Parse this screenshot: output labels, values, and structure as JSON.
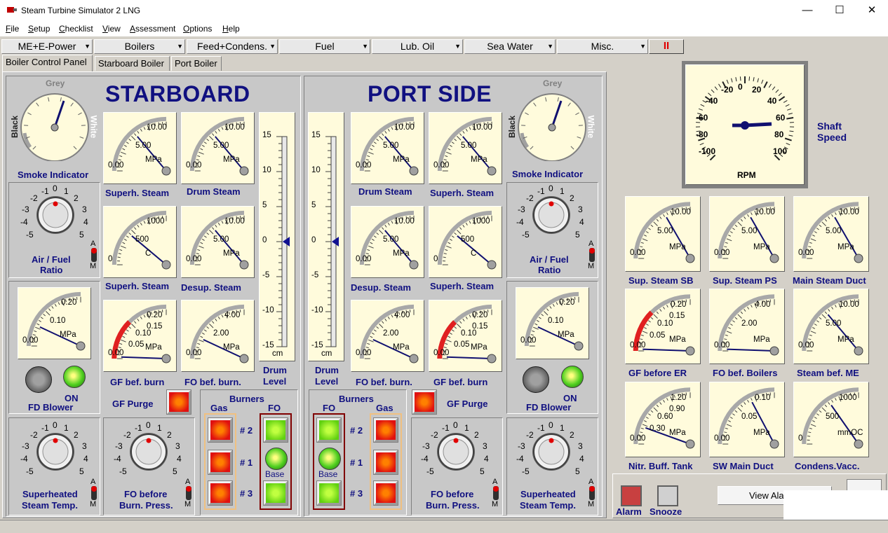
{
  "window": {
    "title": "Steam Turbine Simulator 2 LNG"
  },
  "menu": [
    "File",
    "Setup",
    "Checklist",
    "View",
    "Assessment",
    "Options",
    "Help"
  ],
  "systems": [
    "ME+E-Power",
    "Boilers",
    "Feed+Condens.",
    "Fuel",
    "Lub. Oil",
    "Sea Water",
    "Misc."
  ],
  "pause_label": "II",
  "tabs": [
    "Boiler Control Panel",
    "Starboard Boiler",
    "Port Boiler"
  ],
  "starboard": {
    "title": "STARBOARD",
    "smoke": {
      "label": "Smoke Indicator",
      "top": "Grey",
      "left": "Black",
      "right": "White"
    },
    "air_fuel": {
      "label1": "Air / Fuel",
      "label2": "Ratio"
    },
    "fd_blower": {
      "label": "FD Blower",
      "state": "ON"
    },
    "sh_temp": {
      "label1": "Superheated",
      "label2": "Steam Temp."
    },
    "fo_press": {
      "label1": "FO before",
      "label2": "Burn. Press."
    },
    "gf_purge": "GF Purge",
    "burners": {
      "title": "Burners",
      "gas": "Gas",
      "fo": "FO",
      "n2": "# 2",
      "n1": "# 1",
      "n3": "# 3",
      "base": "Base"
    },
    "drum_level": {
      "label1": "Drum",
      "label2": "Level",
      "unit": "cm"
    },
    "gauges": {
      "superh_steam": "Superh. Steam",
      "drum_steam": "Drum Steam",
      "superh_steam_temp": "Superh. Steam",
      "desup_steam": "Desup. Steam",
      "gf_bef_burn": "GF bef. burn",
      "fo_bef_burn": "FO bef. burn."
    }
  },
  "port": {
    "title": "PORT SIDE",
    "smoke": {
      "label": "Smoke Indicator",
      "top": "Grey",
      "left": "Black",
      "right": "White"
    },
    "air_fuel": {
      "label1": "Air / Fuel",
      "label2": "Ratio"
    },
    "fd_blower": {
      "label": "FD Blower",
      "state": "ON"
    },
    "sh_temp": {
      "label1": "Superheated",
      "label2": "Steam Temp."
    },
    "fo_press": {
      "label1": "FO before",
      "label2": "Burn. Press."
    },
    "gf_purge": "GF Purge",
    "burners": {
      "title": "Burners",
      "gas": "Gas",
      "fo": "FO",
      "n2": "# 2",
      "n1": "# 1",
      "n3": "# 3",
      "base": "Base"
    },
    "drum_level": {
      "label1": "Drum",
      "label2": "Level",
      "unit": "cm"
    },
    "gauges": {
      "drum_steam": "Drum Steam",
      "superh_steam": "Superh. Steam",
      "desup_steam": "Desup. Steam",
      "superh_steam_temp": "Superh. Steam",
      "fo_bef_burn": "FO bef. burn.",
      "gf_bef_burn": "GF bef. burn"
    }
  },
  "knob_ticks": [
    "-1",
    "0",
    "1",
    "-2",
    "2",
    "-3",
    "3",
    "-4",
    "4",
    "-5",
    "5"
  ],
  "am": {
    "a": "A",
    "m": "M"
  },
  "level_ticks": [
    "15",
    "10",
    "5",
    "0",
    "-5",
    "-10",
    "-15"
  ],
  "shaft": {
    "label1": "Shaft",
    "label2": "Speed",
    "unit": "RPM",
    "ticks": [
      "-20",
      "0",
      "20",
      "-40",
      "40",
      "-60",
      "60",
      "-80",
      "80",
      "-100",
      "100"
    ]
  },
  "right_gauges": [
    {
      "label": "Sup. Steam SB",
      "ticks": [
        "0.00",
        "5.00",
        "10.00"
      ],
      "unit": "MPa"
    },
    {
      "label": "Sup. Steam PS",
      "ticks": [
        "0.00",
        "5.00",
        "10.00"
      ],
      "unit": "MPa"
    },
    {
      "label": "Main Steam Duct",
      "ticks": [
        "0.00",
        "5.00",
        "10.00"
      ],
      "unit": "MPa"
    },
    {
      "label": "GF before ER",
      "ticks": [
        "0.00",
        "0.05",
        "0.10",
        "0.15",
        "0.20"
      ],
      "unit": "MPa"
    },
    {
      "label": "FO bef. Boilers",
      "ticks": [
        "0.00",
        "2.00",
        "4.00"
      ],
      "unit": "MPa"
    },
    {
      "label": "Steam bef. ME",
      "ticks": [
        "0.00",
        "5.00",
        "10.00"
      ],
      "unit": "MPa"
    },
    {
      "label": "Nitr. Buff. Tank",
      "ticks": [
        "0.00",
        "0.30",
        "0.60",
        "0.90",
        "1.20"
      ],
      "unit": "MPa"
    },
    {
      "label": "SW Main Duct",
      "ticks": [
        "0.00",
        "0.05",
        "0.10"
      ],
      "unit": "MPa"
    },
    {
      "label": "Condens.Vacc.",
      "ticks": [
        "0",
        "500",
        "1000"
      ],
      "unit": "mmOC"
    }
  ],
  "alarm": {
    "alarm": "Alarm",
    "snooze": "Snooze",
    "view": "View Ala"
  },
  "gauge_ticks": {
    "mpa10": [
      "0.00",
      "5.00",
      "10.00"
    ],
    "temp": [
      "0",
      "500",
      "1000"
    ],
    "gf": [
      "0.00",
      "0.05",
      "0.10",
      "0.15",
      "0.20"
    ],
    "fo": [
      "0.00",
      "2.00",
      "4.00"
    ],
    "smp": [
      "0.00",
      "0.10",
      "0.20"
    ],
    "unit_mpa": "MPa",
    "unit_c": "C"
  },
  "colors": {
    "navy": "#101080",
    "bg": "#c8c8c8",
    "dial": "#fffbdc",
    "red": "#e02020",
    "green": "#80e020"
  }
}
